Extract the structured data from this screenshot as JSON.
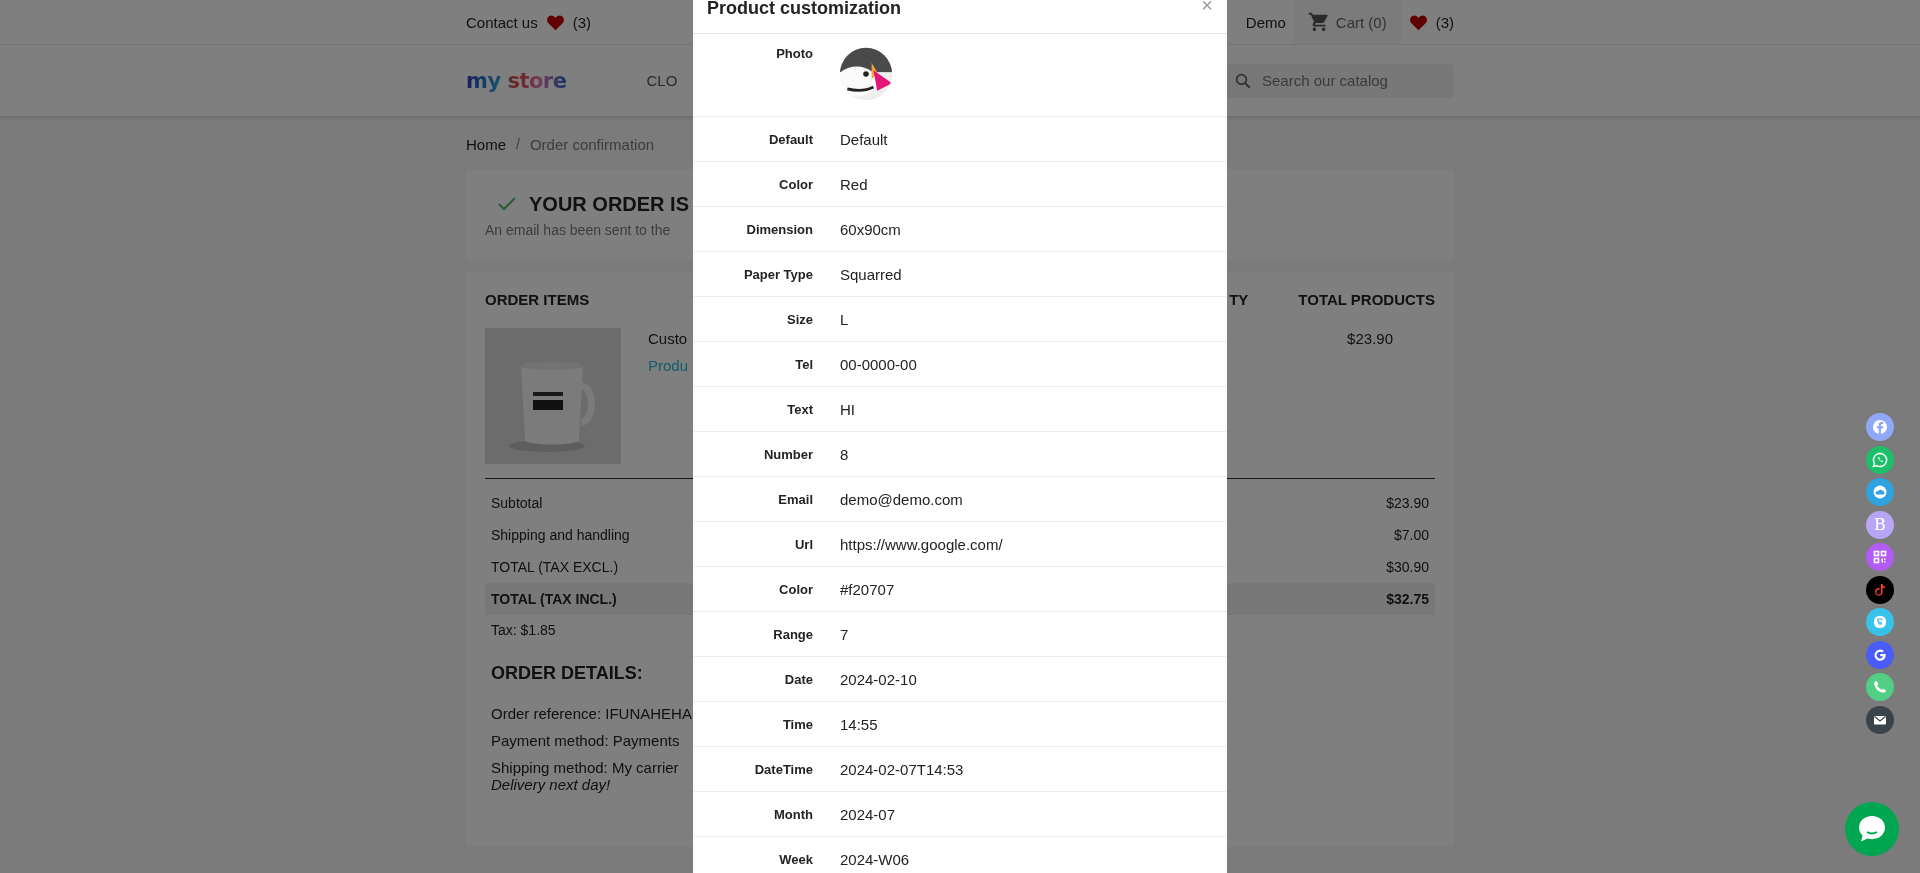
{
  "top_bar": {
    "contact": "Contact us",
    "wishlist_count": "(3)",
    "account": "Demo",
    "cart": "Cart (0)",
    "wishlist_count_right": "(3)"
  },
  "header": {
    "logo": "my store",
    "menu": [
      "CLO"
    ],
    "search": {
      "placeholder": "Search our catalog"
    }
  },
  "breadcrumb": [
    "Home",
    "Order confirmation"
  ],
  "breadcrumb_separator": "/",
  "confirmation": {
    "title": "YOUR ORDER IS",
    "message": "An email has been sent to the"
  },
  "order_items": {
    "heading": "ORDER ITEMS",
    "columns": [
      "TY",
      "TOTAL PRODUCTS"
    ],
    "product": {
      "name": "Custo",
      "link": "Produ",
      "total": "$23.90"
    },
    "totals": [
      {
        "label": "Subtotal",
        "value": "$23.90",
        "emphasis": false
      },
      {
        "label": "Shipping and handling",
        "value": "$7.00",
        "emphasis": false
      },
      {
        "label": "TOTAL (TAX EXCL.)",
        "value": "$30.90",
        "emphasis": false
      },
      {
        "label": "TOTAL (TAX INCL.)",
        "value": "$32.75",
        "emphasis": true
      }
    ],
    "tax": "Tax: $1.85"
  },
  "order_details": {
    "heading": "ORDER DETAILS:",
    "lines": [
      "Order reference: IFUNAHEHA",
      "Payment method: Payments",
      "Shipping method: My carrier"
    ],
    "note": "Delivery next day!"
  },
  "modal": {
    "title": "Product customization",
    "close": "×",
    "rows": [
      {
        "label": "Photo",
        "kind": "picture"
      },
      {
        "label": "Default",
        "value": "Default",
        "kind": "text"
      },
      {
        "label": "Color",
        "value": "Red",
        "kind": "text"
      },
      {
        "label": "Dimension",
        "value": "60x90cm",
        "kind": "text"
      },
      {
        "label": "Paper Type",
        "value": "Squarred",
        "kind": "text"
      },
      {
        "label": "Size",
        "value": "L",
        "kind": "text"
      },
      {
        "label": "Tel",
        "value": "00-0000-00",
        "kind": "text"
      },
      {
        "label": "Text",
        "value": "HI",
        "kind": "text"
      },
      {
        "label": "Number",
        "value": "8",
        "kind": "text"
      },
      {
        "label": "Email",
        "value": "demo@demo.com",
        "kind": "text"
      },
      {
        "label": "Url",
        "value": "https://www.google.com/",
        "kind": "text"
      },
      {
        "label": "Color",
        "value": "#f20707",
        "kind": "text"
      },
      {
        "label": "Range",
        "value": "7",
        "kind": "text"
      },
      {
        "label": "Date",
        "value": "2024-02-10",
        "kind": "text"
      },
      {
        "label": "Time",
        "value": "14:55",
        "kind": "text"
      },
      {
        "label": "DateTime",
        "value": "2024-02-07T14:53",
        "kind": "text"
      },
      {
        "label": "Month",
        "value": "2024-07",
        "kind": "text"
      },
      {
        "label": "Week",
        "value": "2024-W06",
        "kind": "text"
      }
    ]
  },
  "social": [
    {
      "kind": "facebook",
      "color": "#8fa8f7"
    },
    {
      "kind": "whatsapp",
      "color": "#1fbf6a"
    },
    {
      "kind": "cloud",
      "color": "#2ea3dd"
    },
    {
      "kind": "letter",
      "color": "#b8a6f5",
      "glyph": "B"
    },
    {
      "kind": "qr",
      "color": "#b35cf5"
    },
    {
      "kind": "note",
      "color": "#000000"
    },
    {
      "kind": "skype",
      "color": "#38c2ea"
    },
    {
      "kind": "google",
      "color": "#4a5cf7"
    },
    {
      "kind": "phone",
      "color": "#52cf85"
    },
    {
      "kind": "mail",
      "color": "#38444a"
    }
  ]
}
